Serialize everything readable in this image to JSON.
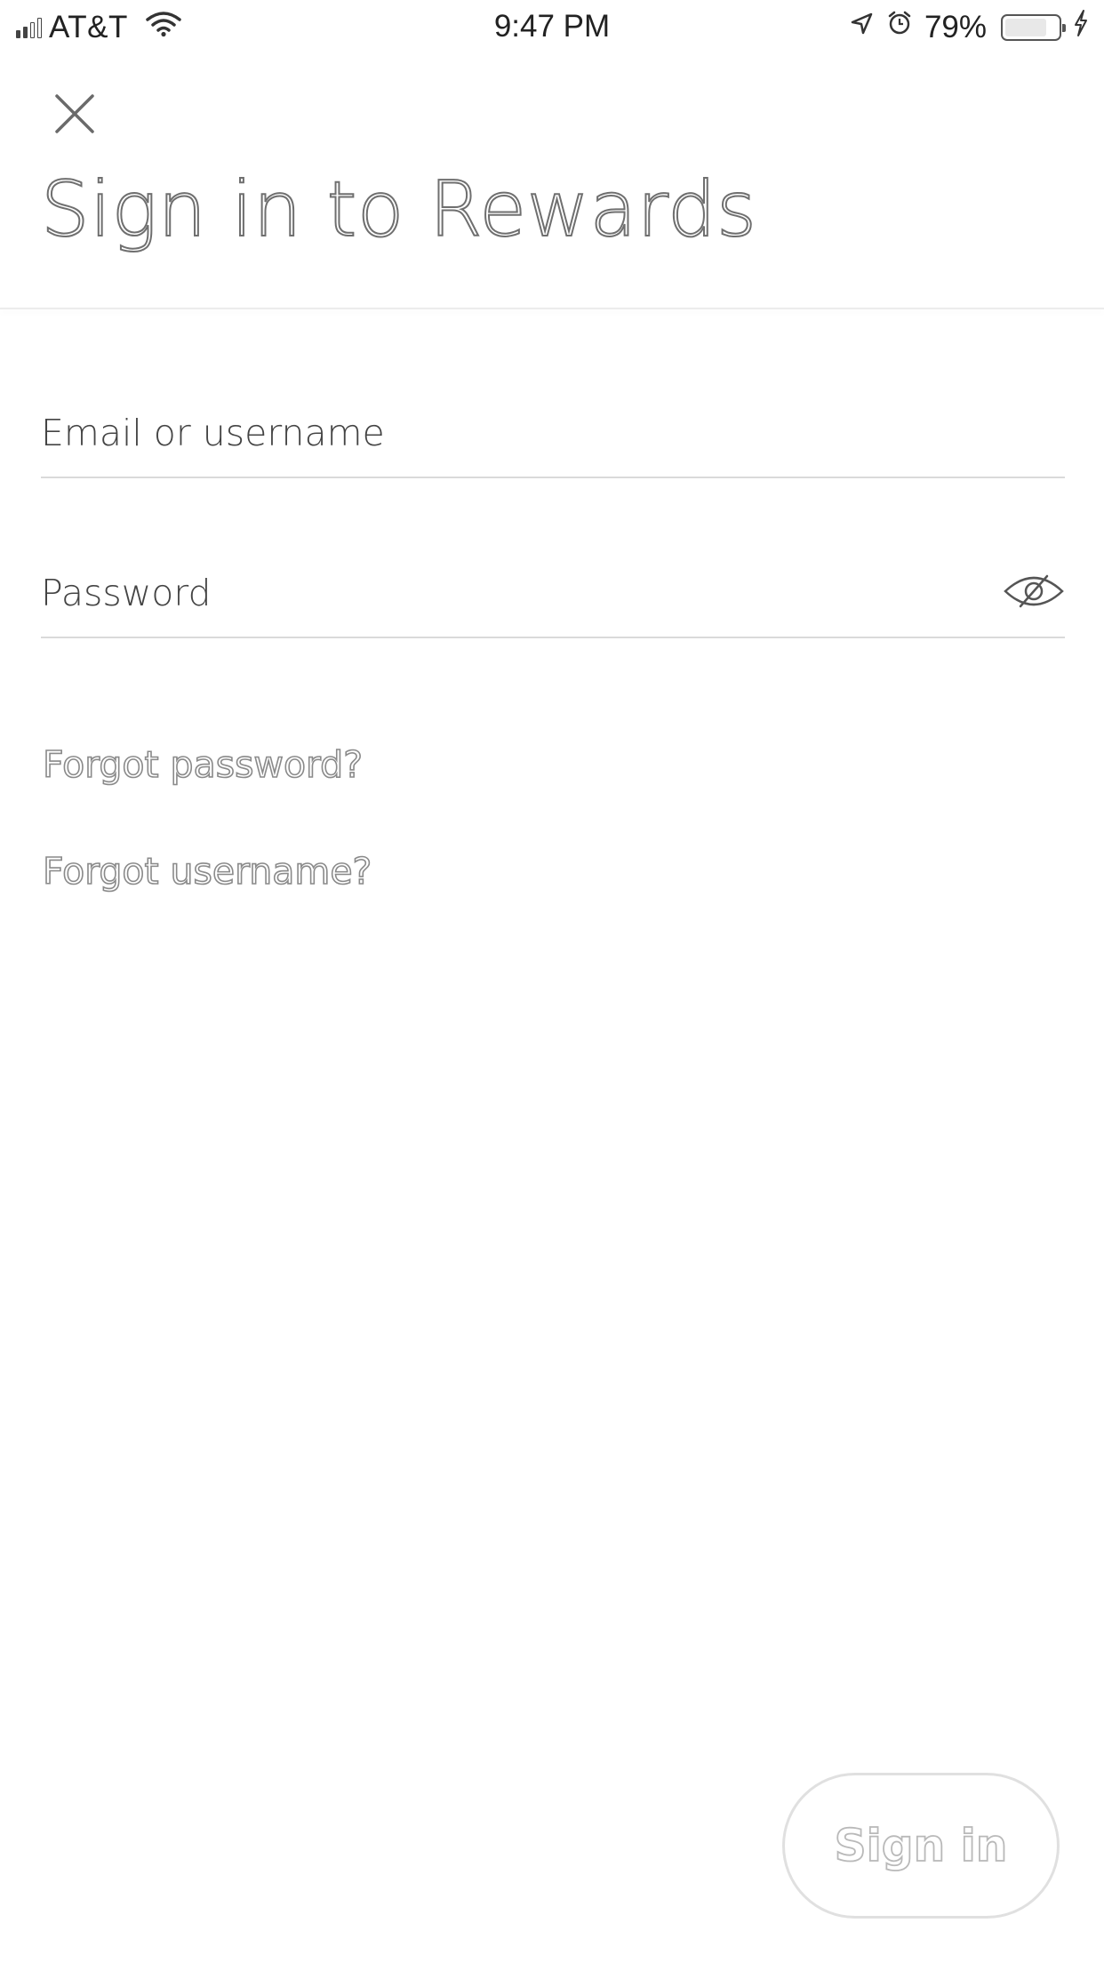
{
  "status_bar": {
    "carrier": "AT&T",
    "time": "9:47 PM",
    "battery_percent": "79%",
    "battery_level": 0.79,
    "signal_bars_filled": 2,
    "signal_bars_total": 4,
    "icons": [
      "signal-bars-icon",
      "wifi-icon",
      "location-arrow-icon",
      "alarm-icon",
      "battery-icon",
      "charging-bolt-icon"
    ]
  },
  "header": {
    "close_icon": "close-icon",
    "title": "Sign in to Rewards"
  },
  "form": {
    "email_placeholder": "Email or username",
    "email_value": "",
    "password_placeholder": "Password",
    "password_value": "",
    "password_toggle_icon": "eye-slash-icon"
  },
  "links": {
    "forgot_password": "Forgot password?",
    "forgot_username": "Forgot username?"
  },
  "actions": {
    "sign_in_label": "Sign in",
    "sign_in_enabled": false
  },
  "colors": {
    "background": "#ffffff",
    "title_outline": "#6f6f6f",
    "divider": "#dadada",
    "link_outline": "#8a8a8a",
    "button_border": "#e0e0e0"
  }
}
